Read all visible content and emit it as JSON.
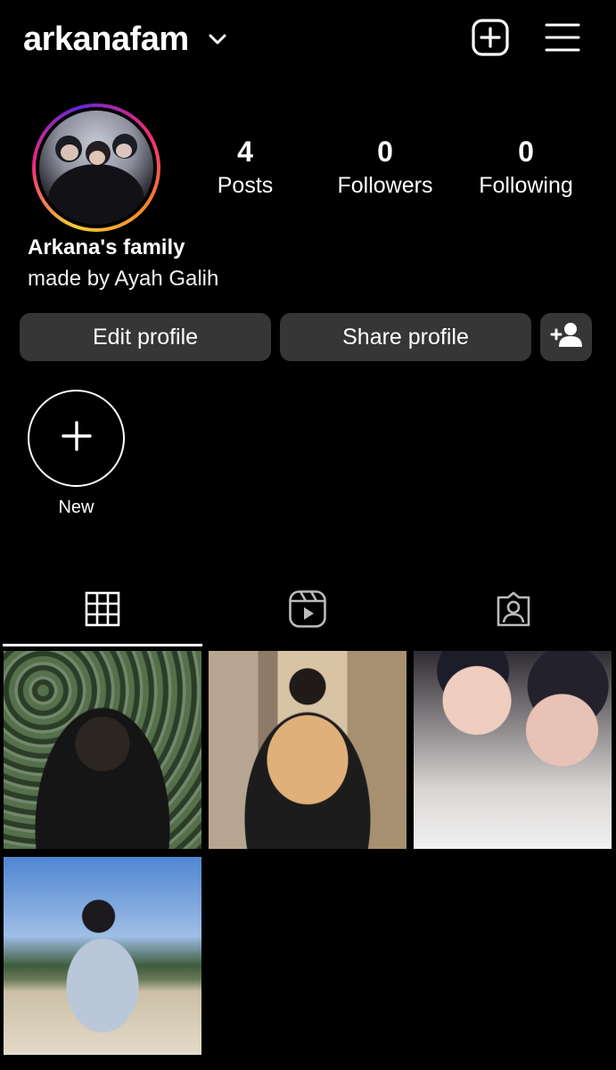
{
  "header": {
    "username": "arkanafam",
    "icons": {
      "dropdown": "chevron-down-icon",
      "create": "add-square-icon",
      "menu": "hamburger-menu-icon"
    }
  },
  "profile": {
    "avatar_alt": "profile-picture",
    "stats": [
      {
        "value": "4",
        "label": "Posts"
      },
      {
        "value": "0",
        "label": "Followers"
      },
      {
        "value": "0",
        "label": "Following"
      }
    ],
    "display_name": "Arkana's family",
    "bio": "made by Ayah Galih"
  },
  "actions": {
    "edit_label": "Edit profile",
    "share_label": "Share profile",
    "discover_icon": "add-person-icon"
  },
  "highlights": {
    "new_label": "New"
  },
  "tabs": [
    {
      "name": "grid",
      "icon": "grid-icon",
      "selected": true
    },
    {
      "name": "reels",
      "icon": "reels-icon",
      "selected": false
    },
    {
      "name": "tagged",
      "icon": "tagged-icon",
      "selected": false
    }
  ],
  "posts_count_displayed": 4,
  "colors": {
    "background": "#000000",
    "button_bg": "#363636",
    "text": "#ffffff"
  }
}
